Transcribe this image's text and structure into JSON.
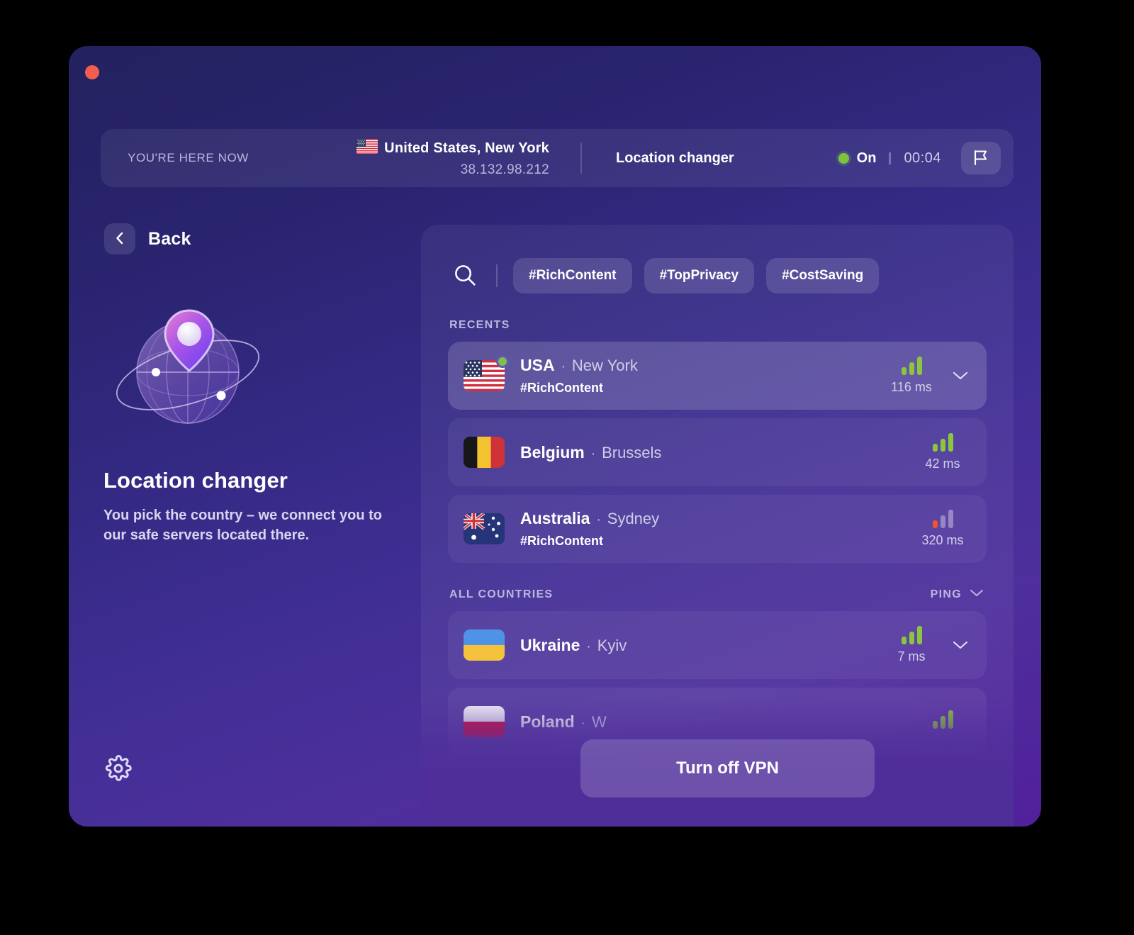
{
  "window": {
    "close_button": "close-window"
  },
  "statusbar": {
    "here_label": "YOU'RE HERE NOW",
    "location": "United States, New York",
    "location_flag": "us-flag-icon",
    "ip_address": "38.132.98.212",
    "feature_name": "Location changer",
    "state_label": "On",
    "timer": "00:04",
    "flag_button": "flag-icon"
  },
  "left": {
    "back_label": "Back",
    "title": "Location changer",
    "description": "You pick the country – we connect you to our safe servers located there.",
    "settings_icon": "gear-icon"
  },
  "search": {
    "icon": "search-icon",
    "tags": [
      {
        "label": "#RichContent"
      },
      {
        "label": "#TopPrivacy"
      },
      {
        "label": "#CostSaving"
      }
    ]
  },
  "sections": {
    "recents_title": "RECENTS",
    "all_countries_title": "ALL COUNTRIES",
    "sort_label": "PING"
  },
  "recents": [
    {
      "country": "USA",
      "separator": "·",
      "city": "New York",
      "tag": "#RichContent",
      "ping": "116 ms",
      "flag": "us-flag-icon",
      "online": true,
      "selected": true,
      "expandable": true,
      "signal": {
        "bars": 3,
        "color": "#8cc63f"
      }
    },
    {
      "country": "Belgium",
      "separator": "·",
      "city": "Brussels",
      "tag": "",
      "ping": "42 ms",
      "flag": "be-flag-icon",
      "online": false,
      "selected": false,
      "expandable": false,
      "signal": {
        "bars": 3,
        "color": "#8cc63f"
      }
    },
    {
      "country": "Australia",
      "separator": "·",
      "city": "Sydney",
      "tag": "#RichContent",
      "ping": "320 ms",
      "flag": "au-flag-icon",
      "online": false,
      "selected": false,
      "expandable": false,
      "signal": {
        "bars": 1,
        "color": "#f0542d"
      }
    }
  ],
  "all_countries": [
    {
      "country": "Ukraine",
      "separator": "·",
      "city": "Kyiv",
      "tag": "",
      "ping": "7 ms",
      "flag": "ua-flag-icon",
      "online": false,
      "selected": false,
      "expandable": true,
      "signal": {
        "bars": 3,
        "color": "#8cc63f"
      }
    },
    {
      "country": "Poland",
      "separator": "·",
      "city": "W",
      "tag": "",
      "ping": "",
      "flag": "pl-flag-icon",
      "online": false,
      "selected": false,
      "expandable": false,
      "signal": {
        "bars": 3,
        "color": "#8cc63f"
      }
    }
  ],
  "footer": {
    "turn_off_label": "Turn off VPN"
  },
  "colors": {
    "accent_green": "#7dc242",
    "accent_red": "#f0542d",
    "close_dot": "#f05f4e",
    "bg_start": "#23215e",
    "bg_end": "#51209b"
  }
}
